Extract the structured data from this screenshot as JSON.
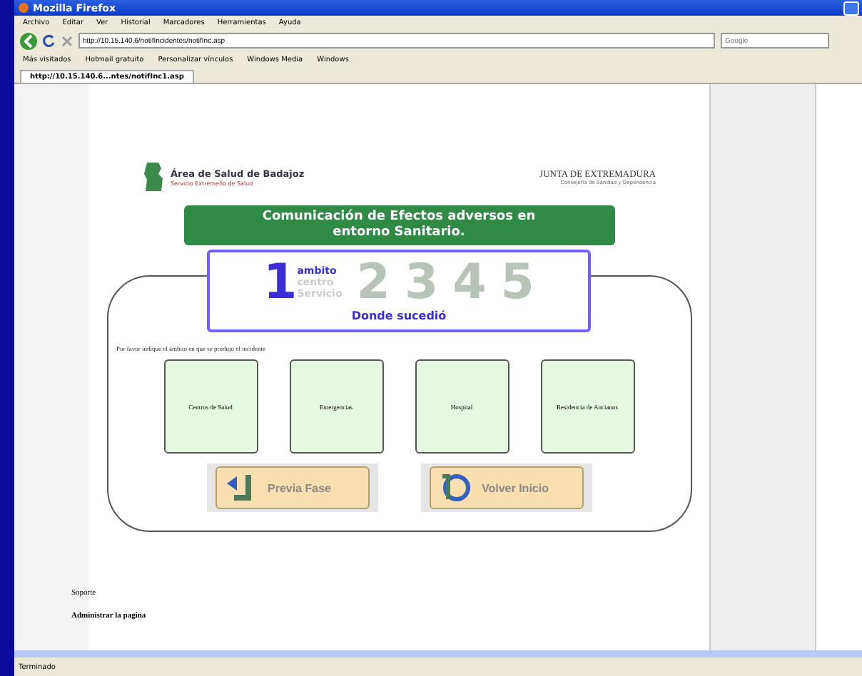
{
  "window": {
    "title": "Mozilla Firefox"
  },
  "menu": [
    "Archivo",
    "Editar",
    "Ver",
    "Historial",
    "Marcadores",
    "Herramientas",
    "Ayuda"
  ],
  "address": {
    "value": "http://10.15.140.6/notifIncidentes/notifInc.asp",
    "search_placeholder": "Google"
  },
  "bookmarks": [
    "Más visitados",
    "Hotmail gratuito",
    "Personalizar vínculos",
    "Windows Media",
    "Windows"
  ],
  "tabs": [
    {
      "label": "http://10.15.140.6...ntes/notifInc1.asp",
      "selected": true
    }
  ],
  "page": {
    "org": "Área de Salud de Badajoz",
    "org_sub": "Servicio Extremeño de Salud",
    "gov": "JUNTA DE EXTREMADURA",
    "gov_sub": "Consejería de Sanidad y Dependencia",
    "banner": "Comunicación de Efectos adversos en entorno Sanitario.",
    "steps": [
      {
        "number": "1",
        "selected": true,
        "labels": [
          "ambito",
          "centro",
          "Servicio"
        ]
      },
      {
        "number": "2",
        "selected": false
      },
      {
        "number": "3",
        "selected": false
      },
      {
        "number": "4",
        "selected": false
      },
      {
        "number": "5",
        "selected": false
      }
    ],
    "step_caption": "Donde sucedió",
    "instruction": "Por favor indique el ámbito en que se produjo el incidente",
    "options": [
      "Centros de Salud",
      "Emergencias",
      "Hospital",
      "Residencia de Ancianos"
    ],
    "buttons": [
      "Previa Fase",
      "Volver Inicio"
    ],
    "footer": [
      "Soporte",
      "Administrar la pagina"
    ]
  },
  "status_bar": "Terminado"
}
